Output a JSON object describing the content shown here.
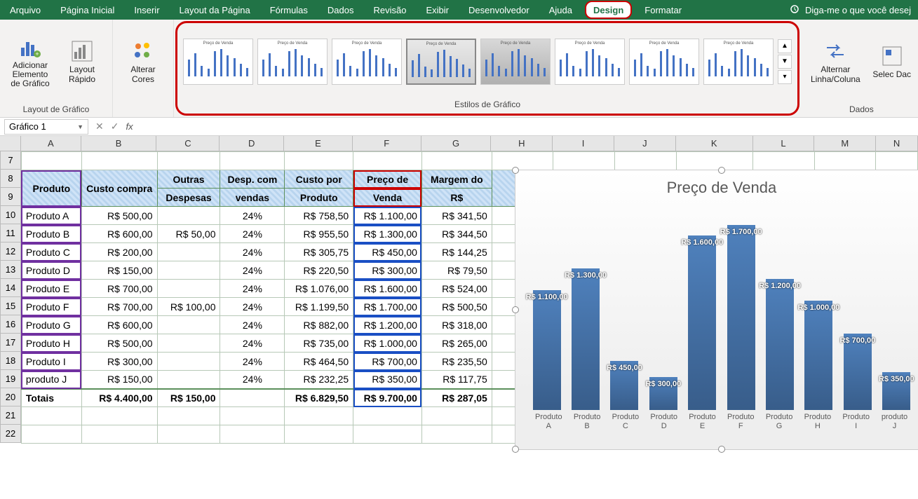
{
  "ribbon": {
    "tabs": [
      "Arquivo",
      "Página Inicial",
      "Inserir",
      "Layout da Página",
      "Fórmulas",
      "Dados",
      "Revisão",
      "Exibir",
      "Desenvolvedor",
      "Ajuda",
      "Design",
      "Formatar"
    ],
    "active_tab": "Design",
    "highlight_tab": "Design",
    "tellme": "Diga-me o que você desej"
  },
  "ribbon_groups": {
    "layout": {
      "label": "Layout de Gráfico",
      "add_element": "Adicionar Elemento de Gráfico",
      "quick_layout": "Layout Rápido"
    },
    "colors": {
      "label": "Alterar Cores"
    },
    "styles": {
      "label": "Estilos de Gráfico",
      "thumb_title": "Preço de Venda",
      "count": 8,
      "selected_index": 3
    },
    "data": {
      "label": "Dados",
      "switch": "Alternar Linha/Coluna",
      "select": "Selec Dac"
    }
  },
  "formula_bar": {
    "name_box": "Gráfico 1",
    "fx": ""
  },
  "columns": [
    "A",
    "B",
    "C",
    "D",
    "E",
    "F",
    "G",
    "H",
    "I",
    "J",
    "K",
    "L",
    "M",
    "N"
  ],
  "first_row": 7,
  "header_row1": [
    "Produto",
    "Custo compra",
    "Outras",
    "Desp. com",
    "Custo por",
    "Preço de",
    "Margem do"
  ],
  "header_row2": [
    "",
    "",
    "Despesas",
    "vendas",
    "Produto",
    "Venda",
    "R$"
  ],
  "table_rows": [
    {
      "r": 10,
      "produto": "Produto A",
      "custo": "R$ 500,00",
      "outras": "",
      "pct": "24%",
      "custo_prod": "R$ 758,50",
      "preco": "R$ 1.100,00",
      "margem": "R$ 341,50"
    },
    {
      "r": 11,
      "produto": "Produto B",
      "custo": "R$ 600,00",
      "outras": "R$ 50,00",
      "pct": "24%",
      "custo_prod": "R$ 955,50",
      "preco": "R$ 1.300,00",
      "margem": "R$ 344,50"
    },
    {
      "r": 12,
      "produto": "Produto C",
      "custo": "R$ 200,00",
      "outras": "",
      "pct": "24%",
      "custo_prod": "R$ 305,75",
      "preco": "R$ 450,00",
      "margem": "R$ 144,25"
    },
    {
      "r": 13,
      "produto": "Produto D",
      "custo": "R$ 150,00",
      "outras": "",
      "pct": "24%",
      "custo_prod": "R$ 220,50",
      "preco": "R$ 300,00",
      "margem": "R$ 79,50"
    },
    {
      "r": 14,
      "produto": "Produto E",
      "custo": "R$ 700,00",
      "outras": "",
      "pct": "24%",
      "custo_prod": "R$ 1.076,00",
      "preco": "R$ 1.600,00",
      "margem": "R$ 524,00"
    },
    {
      "r": 15,
      "produto": "Produto F",
      "custo": "R$ 700,00",
      "outras": "R$ 100,00",
      "pct": "24%",
      "custo_prod": "R$ 1.199,50",
      "preco": "R$ 1.700,00",
      "margem": "R$ 500,50"
    },
    {
      "r": 16,
      "produto": "Produto G",
      "custo": "R$ 600,00",
      "outras": "",
      "pct": "24%",
      "custo_prod": "R$ 882,00",
      "preco": "R$ 1.200,00",
      "margem": "R$ 318,00"
    },
    {
      "r": 17,
      "produto": "Produto H",
      "custo": "R$ 500,00",
      "outras": "",
      "pct": "24%",
      "custo_prod": "R$ 735,00",
      "preco": "R$ 1.000,00",
      "margem": "R$ 265,00"
    },
    {
      "r": 18,
      "produto": "Produto I",
      "custo": "R$ 300,00",
      "outras": "",
      "pct": "24%",
      "custo_prod": "R$ 464,50",
      "preco": "R$ 700,00",
      "margem": "R$ 235,50"
    },
    {
      "r": 19,
      "produto": "produto J",
      "custo": "R$ 150,00",
      "outras": "",
      "pct": "24%",
      "custo_prod": "R$ 232,25",
      "preco": "R$ 350,00",
      "margem": "R$ 117,75"
    }
  ],
  "totals": {
    "r": 20,
    "label": "Totais",
    "custo": "R$ 4.400,00",
    "outras": "R$ 150,00",
    "pct": "",
    "custo_prod": "R$ 6.829,50",
    "preco": "R$ 9.700,00",
    "margem": "R$ 287,05"
  },
  "chart_data": {
    "type": "bar",
    "title": "Preço de Venda",
    "categories": [
      "Produto A",
      "Produto B",
      "Produto C",
      "Produto D",
      "Produto E",
      "Produto F",
      "Produto G",
      "Produto H",
      "Produto I",
      "produto J"
    ],
    "values": [
      1100,
      1300,
      450,
      300,
      1600,
      1700,
      1200,
      1000,
      700,
      350
    ],
    "value_labels": [
      "R$ 1.100,00",
      "R$ 1.300,00",
      "R$ 450,00",
      "R$ 300,00",
      "R$ 1.600,00",
      "R$ 1.700,00",
      "R$ 1.200,00",
      "R$ 1.000,00",
      "R$ 700,00",
      "R$ 350,00"
    ],
    "ylim": [
      0,
      1800
    ]
  }
}
